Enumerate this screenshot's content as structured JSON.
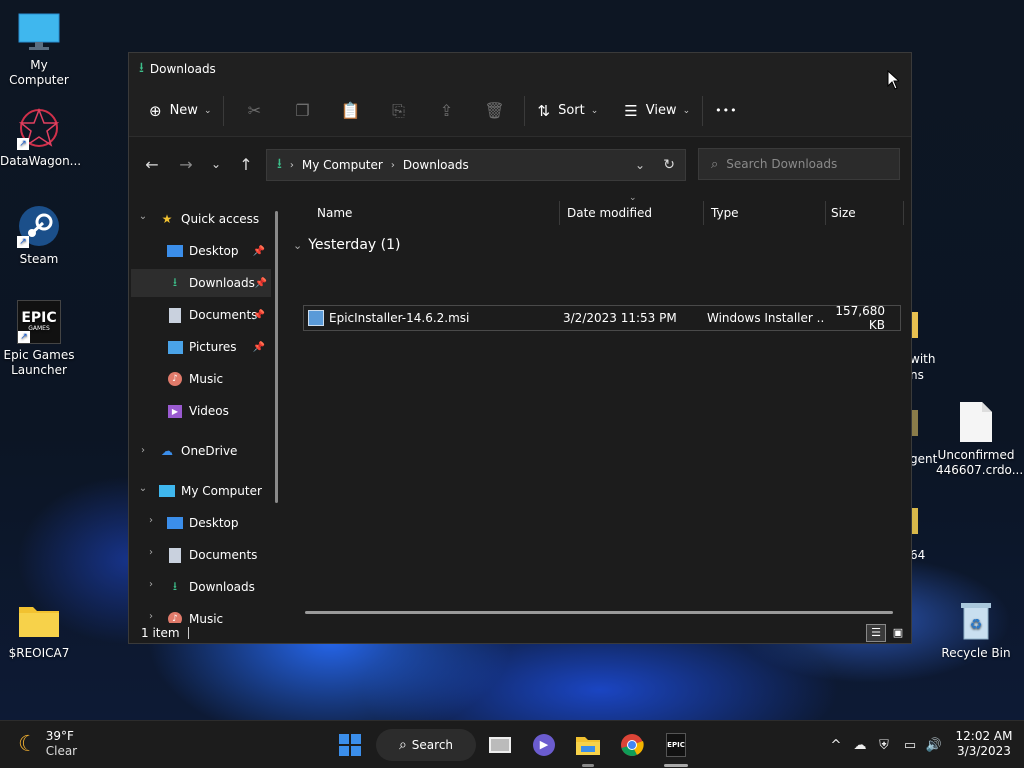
{
  "desktop": {
    "icons_left": [
      {
        "label": "My Computer"
      },
      {
        "label": "DataWagon..."
      },
      {
        "label": "Steam"
      },
      {
        "label": "Epic Games Launcher"
      },
      {
        "label": "$REOICA7"
      }
    ],
    "icons_right": [
      {
        "label": "Unconfirmed 446607.crdo..."
      },
      {
        "label": "Recycle Bin"
      }
    ],
    "partial_labels": [
      "with",
      "ns",
      "gent",
      "64"
    ],
    "epic_logo_text": "EPIC",
    "epic_logo_sub": "GAMES"
  },
  "window": {
    "title": "Downloads",
    "toolbar": {
      "new_label": "New",
      "sort_label": "Sort",
      "view_label": "View",
      "more_label": "•••"
    },
    "address": {
      "crumbs": [
        "My Computer",
        "Downloads"
      ]
    },
    "search": {
      "placeholder": "Search Downloads"
    },
    "nav": {
      "quick_access": "Quick access",
      "desktop": "Desktop",
      "downloads": "Downloads",
      "documents": "Documents",
      "pictures": "Pictures",
      "music": "Music",
      "videos": "Videos",
      "onedrive": "OneDrive",
      "my_computer": "My Computer",
      "mc_desktop": "Desktop",
      "mc_documents": "Documents",
      "mc_downloads": "Downloads",
      "mc_music": "Music"
    },
    "columns": {
      "name": "Name",
      "date_modified": "Date modified",
      "type": "Type",
      "size": "Size"
    },
    "group_header": "Yesterday (1)",
    "files": [
      {
        "name": "EpicInstaller-14.6.2.msi",
        "date": "3/2/2023 11:53 PM",
        "type": "Windows Installer ...",
        "size": "157,680 KB"
      }
    ],
    "status": "1 item"
  },
  "taskbar": {
    "weather_temp": "39°F",
    "weather_desc": "Clear",
    "search_label": "Search",
    "time": "12:02 AM",
    "date": "3/3/2023",
    "epic_text": "EPIC"
  },
  "colors": {
    "accent_green": "#3dbf8a",
    "folder_yellow": "#f2c230",
    "windows_blue": "#3b8eea"
  }
}
